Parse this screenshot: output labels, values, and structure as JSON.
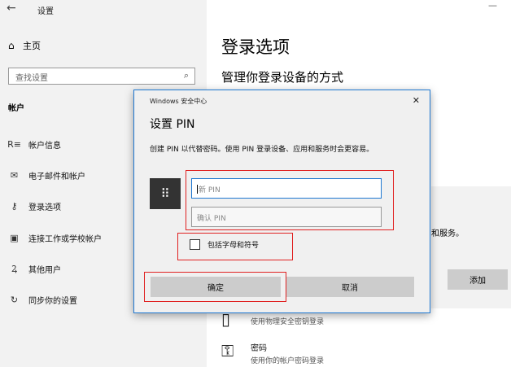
{
  "window": {
    "app_title": "设置",
    "back_glyph": "←",
    "minimize_glyph": "—"
  },
  "sidebar": {
    "home_label": "主页",
    "search_placeholder": "查找设置",
    "section_title": "帐户",
    "items": [
      {
        "label": "帐户信息",
        "icon": "person-list-icon"
      },
      {
        "label": "电子邮件和帐户",
        "icon": "mail-icon"
      },
      {
        "label": "登录选项",
        "icon": "key-icon"
      },
      {
        "label": "连接工作或学校帐户",
        "icon": "briefcase-icon"
      },
      {
        "label": "其他用户",
        "icon": "person-add-icon"
      },
      {
        "label": "同步你的设置",
        "icon": "sync-icon"
      }
    ]
  },
  "main": {
    "title": "登录选项",
    "subtitle": "管理你登录设备的方式",
    "right_text": "和服务。",
    "add_button": "添加",
    "security_key_desc": "使用物理安全密钥登录",
    "password_title": "密码",
    "password_desc": "使用你的帐户密码登录"
  },
  "dialog": {
    "app_name": "Windows 安全中心",
    "title": "设置 PIN",
    "description": "创建 PIN 以代替密码。使用 PIN 登录设备、应用和服务时会更容易。",
    "new_pin_placeholder": "新 PIN",
    "confirm_pin_placeholder": "确认 PIN",
    "checkbox_label": "包括字母和符号",
    "ok_button": "确定",
    "cancel_button": "取消"
  },
  "colors": {
    "accent": "#1f78d1",
    "highlight": "#e02020",
    "sidebar_bg": "#f2f2f2",
    "button_bg": "#cccccc"
  }
}
